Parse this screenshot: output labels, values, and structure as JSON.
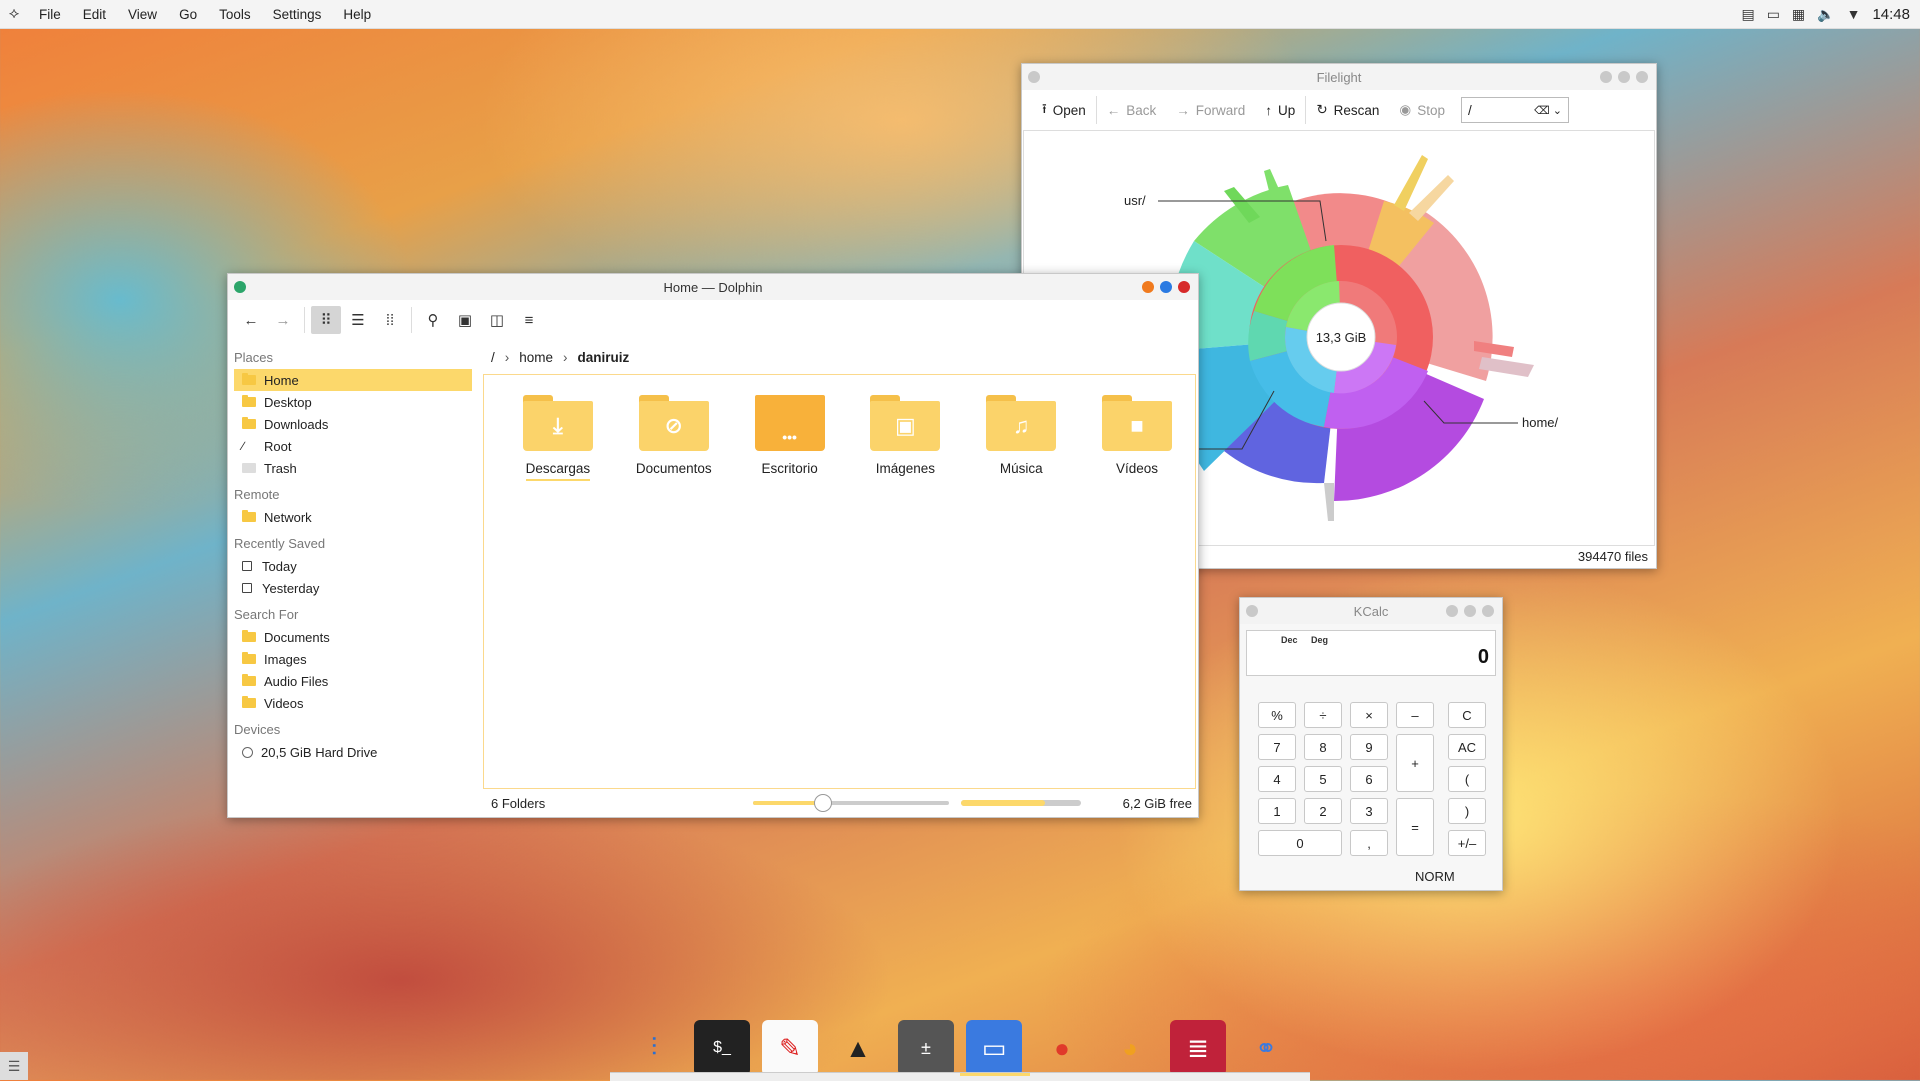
{
  "topbar": {
    "menus": [
      "File",
      "Edit",
      "View",
      "Go",
      "Tools",
      "Settings",
      "Help"
    ],
    "clock": "14:48"
  },
  "dolphin": {
    "title": "Home — Dolphin",
    "breadcrumb": [
      "/",
      "home",
      "daniruiz"
    ],
    "sidebar": {
      "places_header": "Places",
      "places": [
        "Home",
        "Desktop",
        "Downloads",
        "Root",
        "Trash"
      ],
      "remote_header": "Remote",
      "remote": [
        "Network"
      ],
      "recent_header": "Recently Saved",
      "recent": [
        "Today",
        "Yesterday"
      ],
      "search_header": "Search For",
      "search": [
        "Documents",
        "Images",
        "Audio Files",
        "Videos"
      ],
      "devices_header": "Devices",
      "devices": [
        "20,5 GiB Hard Drive"
      ]
    },
    "folders": [
      "Descargas",
      "Documentos",
      "Escritorio",
      "Imágenes",
      "Música",
      "Vídeos"
    ],
    "status_count": "6 Folders",
    "zoom_level": 0.35,
    "space_used_fraction": 0.7,
    "free_space": "6,2 GiB free"
  },
  "filelight": {
    "title": "Filelight",
    "toolbar": {
      "open": "Open",
      "back": "Back",
      "forward": "Forward",
      "up": "Up",
      "rescan": "Rescan",
      "stop": "Stop",
      "path": "/"
    },
    "center_label": "13,3 GiB",
    "label_usr": "usr/",
    "label_home": "home/",
    "files_count": "394470 files"
  },
  "kcalc": {
    "title": "KCalc",
    "mode_dec": "Dec",
    "mode_deg": "Deg",
    "display": "0",
    "keys": {
      "pct": "%",
      "div": "÷",
      "mul": "×",
      "minus": "–",
      "clear": "C",
      "k7": "7",
      "k8": "8",
      "k9": "9",
      "plus": "+",
      "allclear": "AC",
      "k4": "4",
      "k5": "5",
      "k6": "6",
      "lparen": "(",
      "k1": "1",
      "k2": "2",
      "k3": "3",
      "equals": "=",
      "rparen": ")",
      "k0": "0",
      "comma": ",",
      "plusminus": "+/–"
    },
    "norm": "NORM"
  }
}
